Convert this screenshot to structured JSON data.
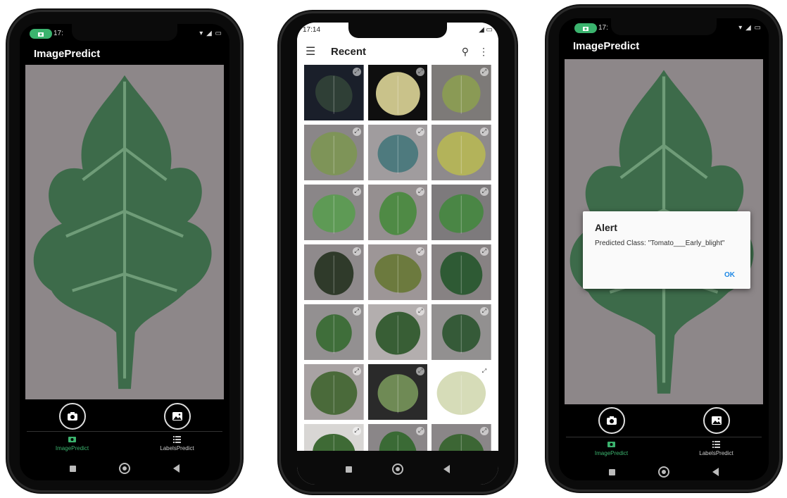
{
  "phone1": {
    "status_time": "17:",
    "status_right": "● ―― ● ● ..• ≡",
    "title": "ImagePredict",
    "nav": [
      {
        "label": "ImagePredict",
        "icon": "camera-icon",
        "active": true
      },
      {
        "label": "LabelsPredict",
        "icon": "list-icon",
        "active": false
      }
    ]
  },
  "phone2": {
    "status_time": "17:14",
    "toolbar_title": "Recent",
    "thumbnails": 21
  },
  "phone3": {
    "status_time": "17:",
    "title": "ImagePredict",
    "alert": {
      "title": "Alert",
      "message": "Predicted Class: \"Tomato___Early_blight\"",
      "ok": "OK"
    },
    "nav": [
      {
        "label": "ImagePredict",
        "icon": "camera-icon",
        "active": true
      },
      {
        "label": "LabelsPredict",
        "icon": "list-icon",
        "active": false
      }
    ]
  },
  "colors": {
    "accent": "#3bb36e",
    "dialog_button": "#1e88e5"
  }
}
